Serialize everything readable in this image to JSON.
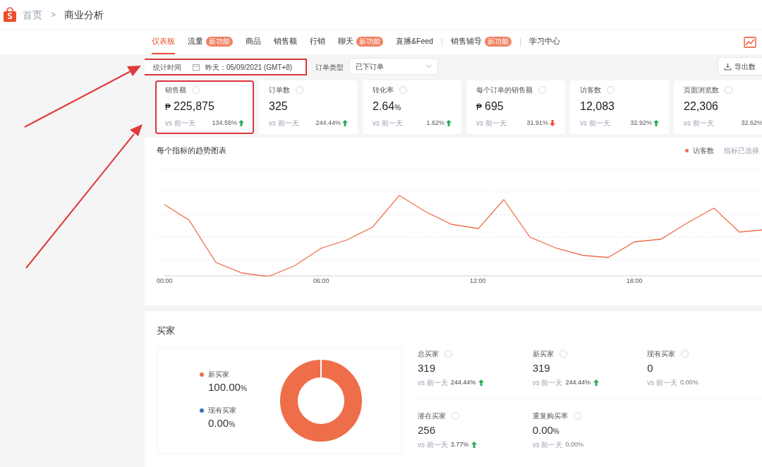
{
  "breadcrumb": {
    "home": "首页",
    "separator": ">",
    "current": "商业分析"
  },
  "nav_tabs": [
    {
      "label": "仪表板",
      "selected": true
    },
    {
      "label": "流量",
      "selected": false,
      "badge": "新功能"
    },
    {
      "label": "商品",
      "selected": false
    },
    {
      "label": "销售额",
      "selected": false
    },
    {
      "label": "行销",
      "selected": false
    },
    {
      "label": "聊天",
      "selected": false,
      "badge": "新功能"
    },
    {
      "label": "直播&Feed",
      "selected": false,
      "divider_after": true
    },
    {
      "label": "销售辅导",
      "selected": false,
      "badge": "新功能",
      "divider_after": true
    },
    {
      "label": "学习中心",
      "selected": false
    }
  ],
  "filters": {
    "time_label": "统计时间",
    "date": "昨天：05/09/2021 (GMT+8)",
    "highlighted": true,
    "order_type_label": "订单类型",
    "order_type": "已下订单",
    "export": "导出数"
  },
  "metrics": [
    {
      "title": "销售额",
      "currency": "₱",
      "value": "225,875",
      "compare": "vs 前一天",
      "change": "134.55%",
      "increase": true,
      "decrease": false,
      "highlighted": true
    },
    {
      "title": "订单数",
      "value": "325",
      "compare": "vs 前一天",
      "change": "244.44%",
      "increase": true,
      "decrease": false,
      "highlighted": false
    },
    {
      "title": "转化率",
      "value": "2.64",
      "unit": "%",
      "compare": "vs 前一天",
      "change": "1.62%",
      "increase": true,
      "decrease": false,
      "highlighted": false
    },
    {
      "title": "每个订单的销售额",
      "currency": "₱",
      "value": "695",
      "compare": "vs 前一天",
      "change": "31.91%",
      "increase": false,
      "decrease": true,
      "highlighted": false
    },
    {
      "title": "访客数",
      "value": "12,083",
      "compare": "vs 前一天",
      "change": "32.92%",
      "increase": true,
      "decrease": false,
      "highlighted": false
    },
    {
      "title": "页面浏览数",
      "value": "22,306",
      "compare": "vs 前一天",
      "change": "32.62%",
      "increase": false,
      "decrease": false,
      "highlighted": false
    }
  ],
  "trend_chart": {
    "title": "每个指标的趋势图表",
    "legend": {
      "label": "访客数",
      "color": "#ee6e4a"
    },
    "selector": "指标已选择",
    "x_labels": [
      "00:00",
      "06:00",
      "12:00",
      "18:00"
    ]
  },
  "buyers": {
    "title": "买家",
    "legend": [
      {
        "label": "新买家",
        "value": "100.00",
        "unit": "%",
        "color": "#ee6e4a"
      },
      {
        "label": "现有买家",
        "value": "0.00",
        "unit": "%",
        "color": "#3b6fb6"
      }
    ],
    "stats": [
      {
        "title": "总买家",
        "value": "319",
        "compare": "vs 前一天",
        "change": "244.44%",
        "increase": true
      },
      {
        "title": "新买家",
        "value": "319",
        "compare": "vs 前一天",
        "change": "244.44%",
        "increase": true
      },
      {
        "title": "现有买家",
        "value": "0",
        "compare": "vs 前一天",
        "change": "0.00%",
        "increase": false
      },
      {
        "title": "潜在买家",
        "value": "256",
        "compare": "vs 前一天",
        "change": "3.77%",
        "increase": true
      },
      {
        "title": "重复购买率",
        "value": "0.00",
        "unit": "%",
        "compare": "vs 前一天",
        "change": "0.00%",
        "increase": false
      }
    ]
  }
}
